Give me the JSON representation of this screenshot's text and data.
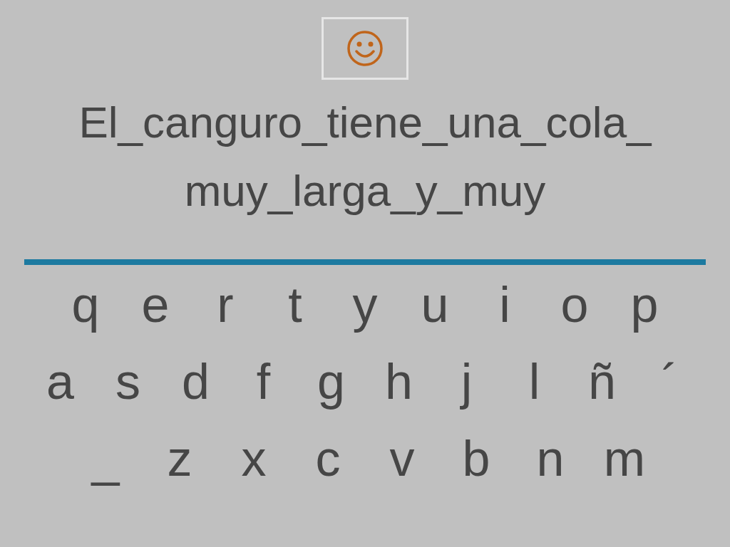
{
  "sentence_lines": [
    "El_canguro_tiene_una_cola_",
    "muy_larga_y_muy"
  ],
  "keyboard_rows": [
    [
      "q",
      "e",
      "r",
      "t",
      "y",
      "u",
      "i",
      "o",
      "p"
    ],
    [
      "a",
      "s",
      "d",
      "f",
      "g",
      "h",
      "j",
      "l",
      "ñ",
      "´"
    ],
    [
      "_",
      "z",
      "x",
      "c",
      "v",
      "b",
      "n",
      "m"
    ]
  ]
}
